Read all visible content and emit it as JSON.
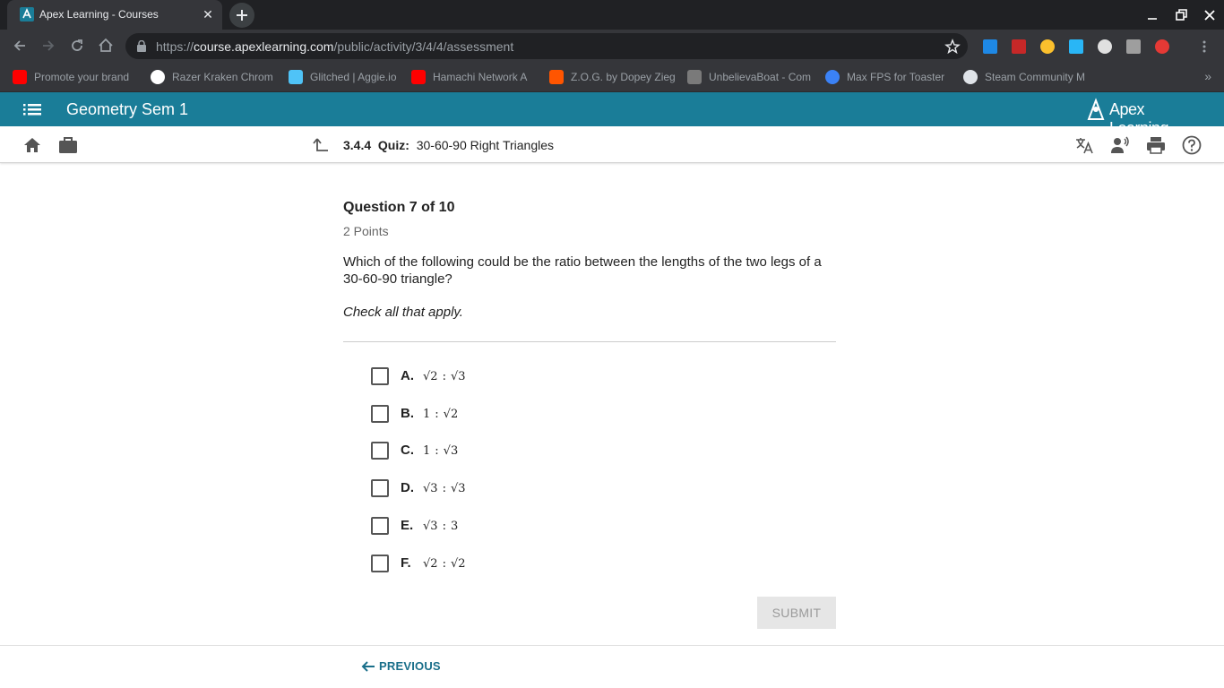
{
  "browser": {
    "tab_title": "Apex Learning - Courses",
    "tab_close": "✕",
    "url_prefix": "https://",
    "url_host": "course.apexlearning.com",
    "url_path": "/public/activity/3/4/4/assessment",
    "bookmarks": [
      {
        "label": "Promote your brand",
        "icon": "youtube-icon",
        "color": "#ff0000"
      },
      {
        "label": "Razer Kraken Chrom",
        "icon": "google-icon",
        "color": "#ffffff"
      },
      {
        "label": "Glitched | Aggie.io",
        "icon": "aggie-icon",
        "color": "#4fc3f7"
      },
      {
        "label": "Hamachi Network A",
        "icon": "youtube-icon",
        "color": "#ff0000"
      },
      {
        "label": "Z.O.G. by Dopey Zieg",
        "icon": "soundcloud-icon",
        "color": "#ff5500"
      },
      {
        "label": "UnbelievaBoat - Com",
        "icon": "unbelievaboat-icon",
        "color": "#7a7a7a"
      },
      {
        "label": "Max FPS for Toaster",
        "icon": "globe-icon",
        "color": "#3b82f6"
      },
      {
        "label": "Steam Community M",
        "icon": "steam-icon",
        "color": "#1b2838"
      }
    ],
    "bookmarks_more": "»"
  },
  "header": {
    "course_title": "Geometry Sem 1",
    "brand": "Apex Learning"
  },
  "activity": {
    "number": "3.4.4",
    "type": "Quiz:",
    "name": "30-60-90 Right Triangles"
  },
  "question": {
    "heading": "Question 7 of 10",
    "points": "2 Points",
    "text": "Which of the following could be the ratio between the lengths of the two legs of a 30-60-90 triangle?",
    "instruction": "Check all that apply.",
    "choices": [
      {
        "letter": "A.",
        "left": "√2",
        "right": "√3"
      },
      {
        "letter": "B.",
        "left": "1",
        "right": "√2"
      },
      {
        "letter": "C.",
        "left": "1",
        "right": "√3"
      },
      {
        "letter": "D.",
        "left": "√3",
        "right": "√3"
      },
      {
        "letter": "E.",
        "left": "√3",
        "right": "3"
      },
      {
        "letter": "F.",
        "left": "√2",
        "right": "√2"
      }
    ],
    "colon": ":"
  },
  "actions": {
    "submit_label": "SUBMIT",
    "previous_label": "PREVIOUS"
  },
  "colors": {
    "header_bg": "#1a7d98",
    "link": "#1a6f8a",
    "submit_disabled_bg": "#e6e6e6"
  }
}
